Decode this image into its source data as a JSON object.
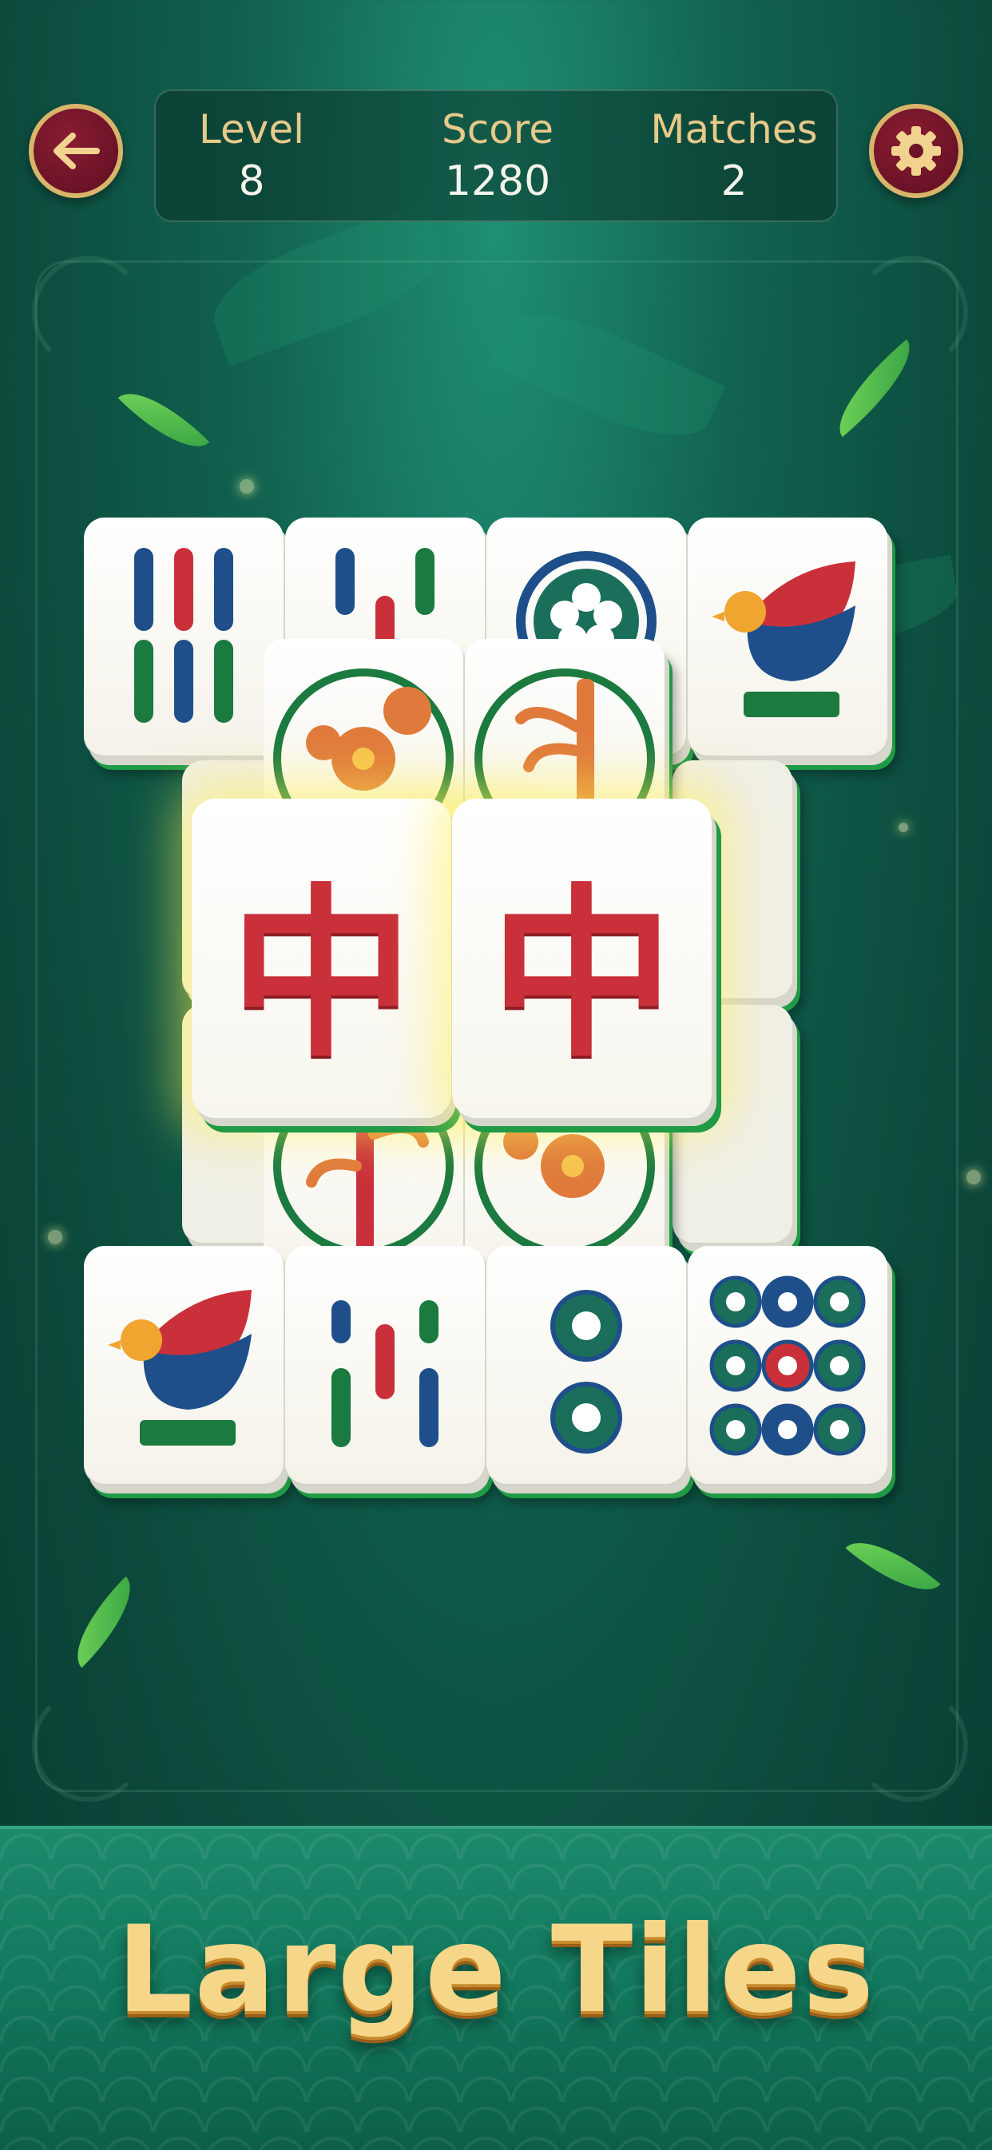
{
  "header": {
    "back_button": {
      "icon": "arrow-left-icon"
    },
    "settings_button": {
      "icon": "gear-icon"
    },
    "stats": [
      {
        "label": "Level",
        "value": "8"
      },
      {
        "label": "Score",
        "value": "1280"
      },
      {
        "label": "Matches",
        "value": "2"
      }
    ]
  },
  "board": {
    "tiles_top_row": [
      "bamboo-six",
      "bamboo-three",
      "circle-flower",
      "bird"
    ],
    "tiles_middle_layer": [
      "flower-season",
      "bamboo-plant"
    ],
    "selected_tiles": [
      {
        "glyph": "中",
        "name": "red-dragon"
      },
      {
        "glyph": "中",
        "name": "red-dragon"
      }
    ],
    "tiles_lower_layer": [
      "bamboo-plant",
      "flower-season"
    ],
    "tiles_bottom_row": [
      "bird",
      "bamboo-five",
      "circle-two",
      "circle-nine"
    ]
  },
  "footer": {
    "headline": "Large Tiles"
  },
  "colors": {
    "accent_gold": "#e7c98a",
    "button_maroon": "#6b1428",
    "tile_red": "#c9303a",
    "tile_green": "#1f9a45",
    "tile_blue": "#1e4f8a"
  }
}
